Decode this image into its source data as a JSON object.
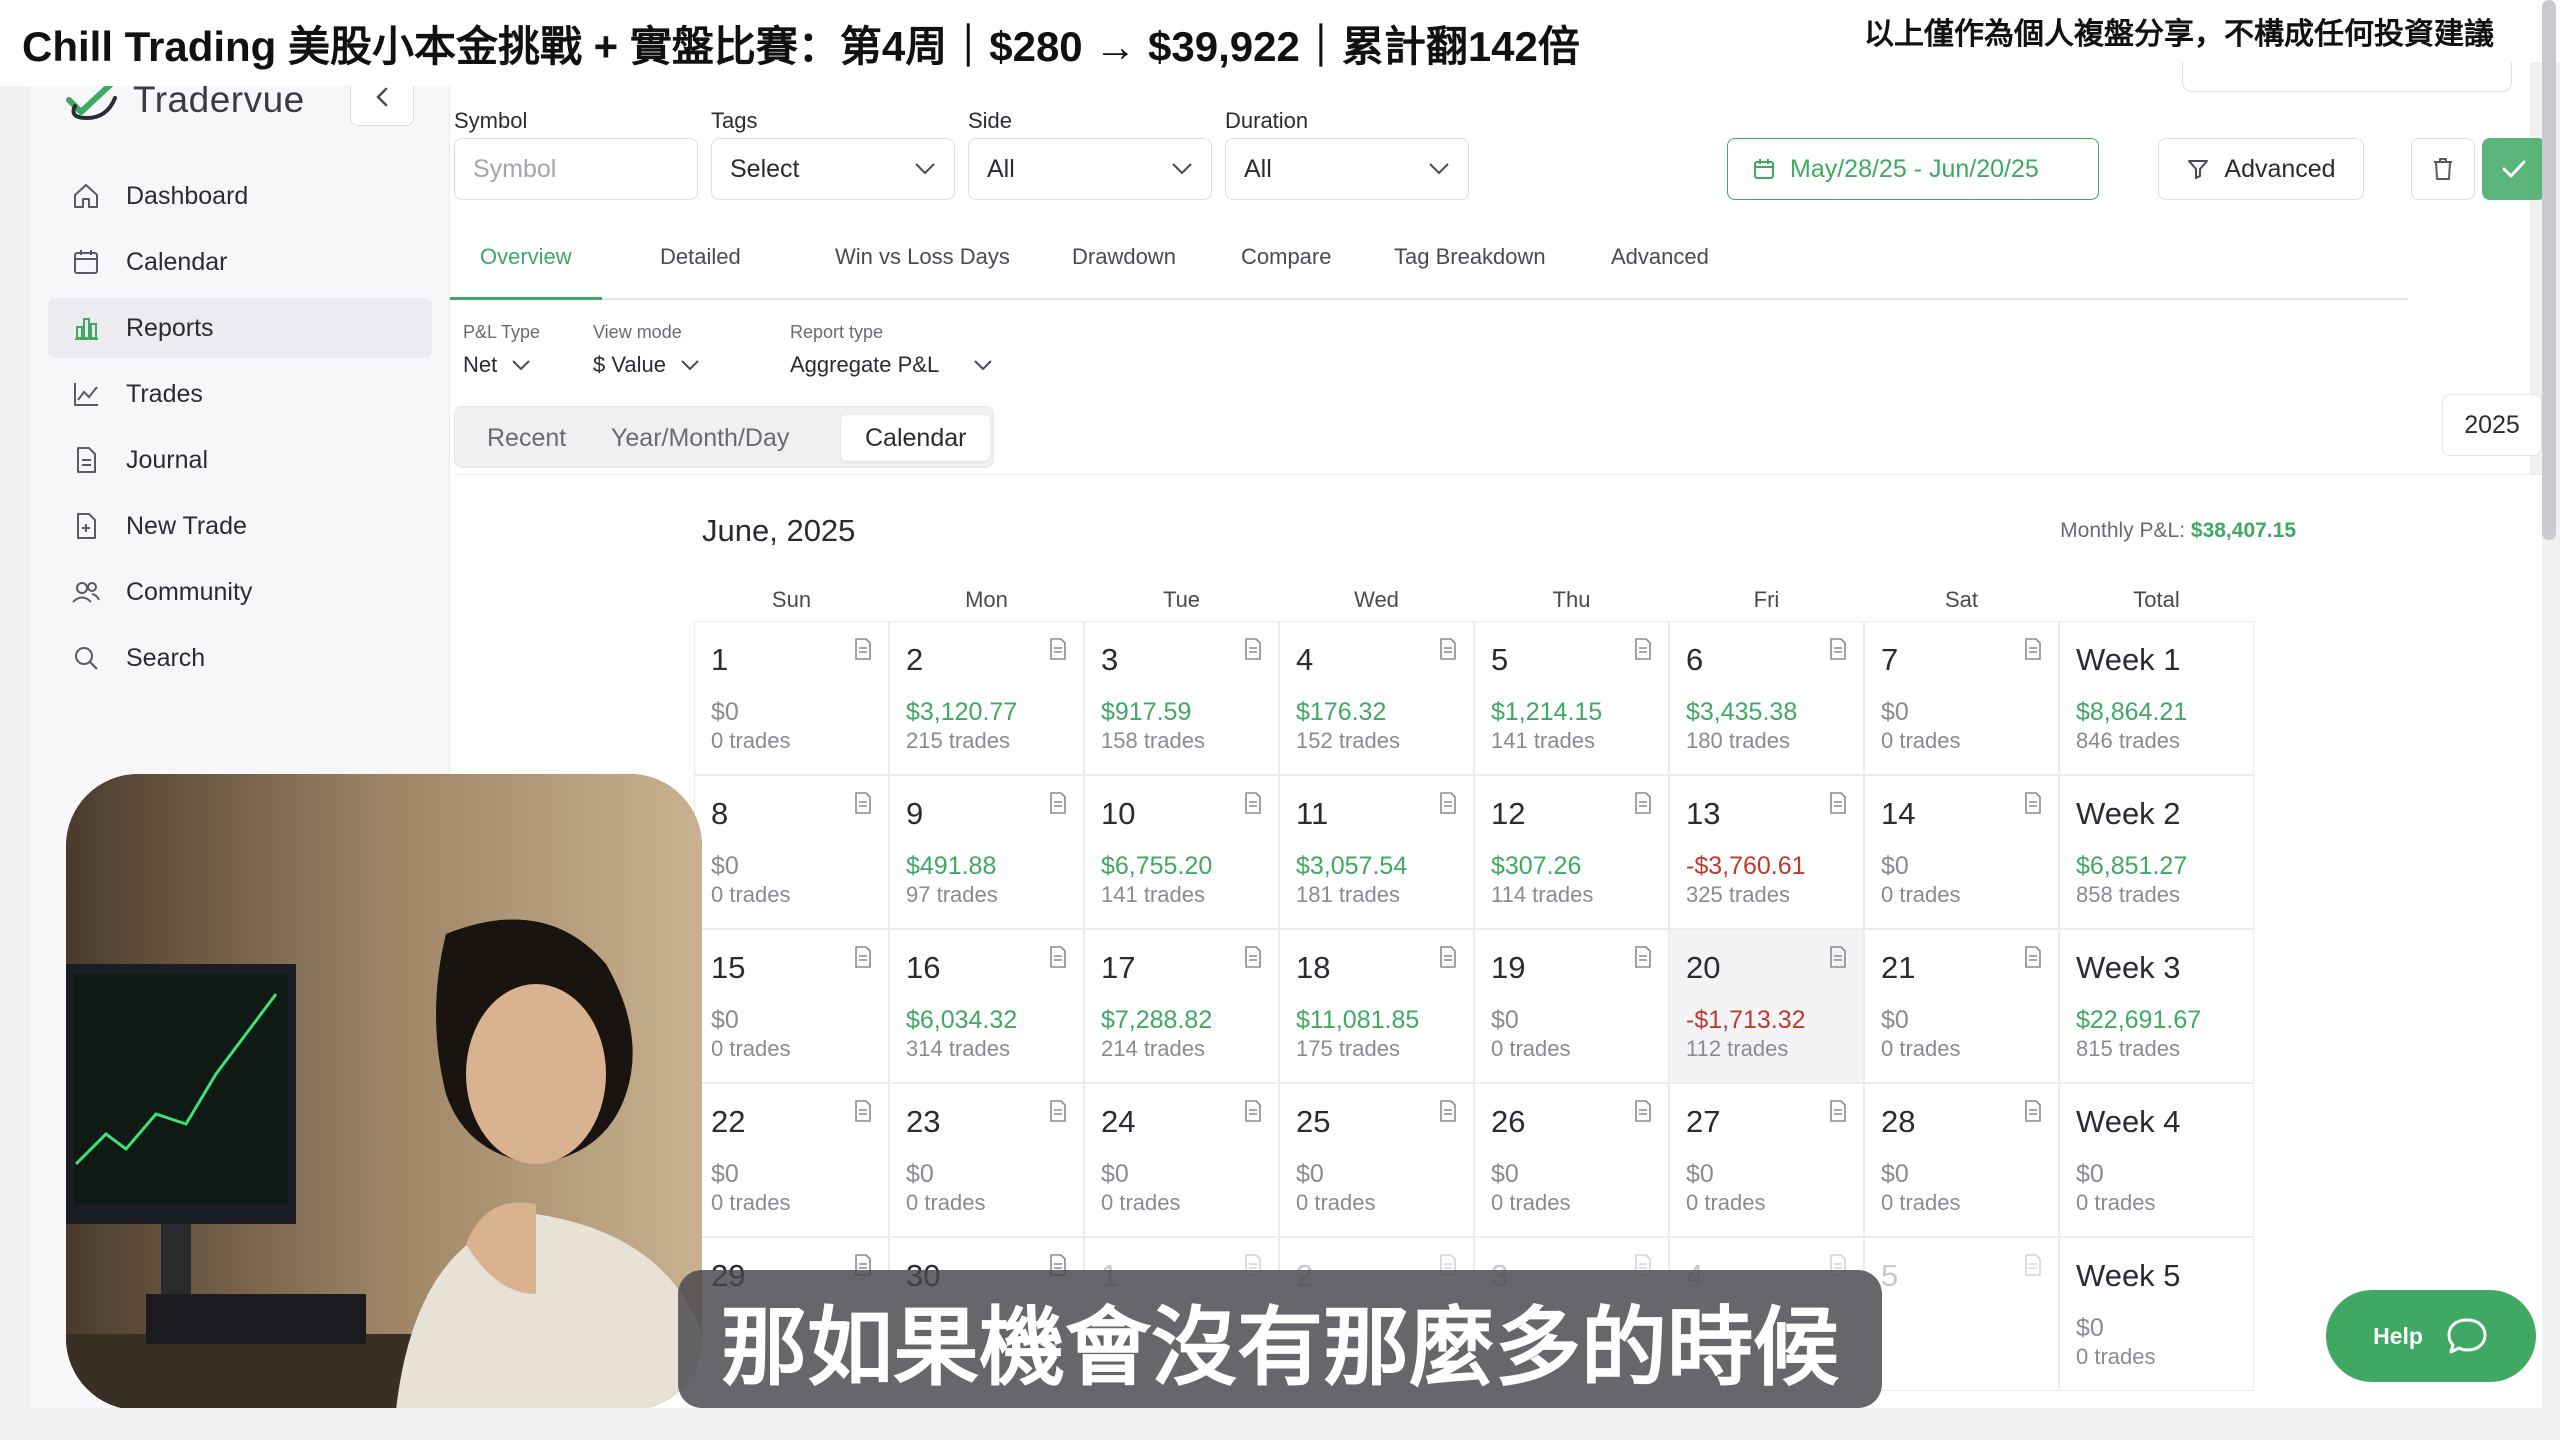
{
  "overlay": {
    "title": "Chill Trading 美股小本金挑戰 + 實盤比賽：第4周｜$280 → $39,922｜累計翻142倍",
    "disclaimer": "以上僅作為個人複盤分享，不構成任何投資建議",
    "subtitle": "那如果機會沒有那麼多的時候"
  },
  "app": {
    "name": "Tradervue"
  },
  "sidebar": {
    "items": [
      {
        "label": "Dashboard",
        "icon": "home-icon"
      },
      {
        "label": "Calendar",
        "icon": "calendar-icon"
      },
      {
        "label": "Reports",
        "icon": "bar-chart-icon",
        "active": true
      },
      {
        "label": "Trades",
        "icon": "line-chart-icon"
      },
      {
        "label": "Journal",
        "icon": "document-icon"
      },
      {
        "label": "New Trade",
        "icon": "new-document-icon"
      },
      {
        "label": "Community",
        "icon": "users-icon"
      },
      {
        "label": "Search",
        "icon": "search-icon"
      }
    ]
  },
  "filters": {
    "symbol": {
      "label": "Symbol",
      "placeholder": "Symbol"
    },
    "tags": {
      "label": "Tags",
      "value": "Select"
    },
    "side": {
      "label": "Side",
      "value": "All"
    },
    "duration": {
      "label": "Duration",
      "value": "All"
    },
    "date_range": "May/28/25 - Jun/20/25",
    "advanced": "Advanced"
  },
  "tabs": [
    "Overview",
    "Detailed",
    "Win vs Loss Days",
    "Drawdown",
    "Compare",
    "Tag Breakdown",
    "Advanced"
  ],
  "options": {
    "pl_type": {
      "label": "P&L Type",
      "value": "Net"
    },
    "view_mode": {
      "label": "View mode",
      "value": "$ Value"
    },
    "report_type": {
      "label": "Report type",
      "value": "Aggregate P&L"
    }
  },
  "view_tabs": [
    "Recent",
    "Year/Month/Day",
    "Calendar"
  ],
  "year": "2025",
  "calendar": {
    "month": "June, 2025",
    "monthly_pnl_label": "Monthly P&L:",
    "monthly_pnl_value": "$38,407.15",
    "headers": [
      "Sun",
      "Mon",
      "Tue",
      "Wed",
      "Thu",
      "Fri",
      "Sat",
      "Total"
    ],
    "weeks": [
      [
        {
          "day": "1",
          "pnl": "$0",
          "trades": "0 trades",
          "tone": "zero"
        },
        {
          "day": "2",
          "pnl": "$3,120.77",
          "trades": "215 trades",
          "tone": "pos"
        },
        {
          "day": "3",
          "pnl": "$917.59",
          "trades": "158 trades",
          "tone": "pos"
        },
        {
          "day": "4",
          "pnl": "$176.32",
          "trades": "152 trades",
          "tone": "pos"
        },
        {
          "day": "5",
          "pnl": "$1,214.15",
          "trades": "141 trades",
          "tone": "pos"
        },
        {
          "day": "6",
          "pnl": "$3,435.38",
          "trades": "180 trades",
          "tone": "pos"
        },
        {
          "day": "7",
          "pnl": "$0",
          "trades": "0 trades",
          "tone": "zero"
        },
        {
          "day": "Week 1",
          "pnl": "$8,864.21",
          "trades": "846 trades",
          "tone": "pos"
        }
      ],
      [
        {
          "day": "8",
          "pnl": "$0",
          "trades": "0 trades",
          "tone": "zero"
        },
        {
          "day": "9",
          "pnl": "$491.88",
          "trades": "97 trades",
          "tone": "pos"
        },
        {
          "day": "10",
          "pnl": "$6,755.20",
          "trades": "141 trades",
          "tone": "pos"
        },
        {
          "day": "11",
          "pnl": "$3,057.54",
          "trades": "181 trades",
          "tone": "pos"
        },
        {
          "day": "12",
          "pnl": "$307.26",
          "trades": "114 trades",
          "tone": "pos"
        },
        {
          "day": "13",
          "pnl": "-$3,760.61",
          "trades": "325 trades",
          "tone": "neg"
        },
        {
          "day": "14",
          "pnl": "$0",
          "trades": "0 trades",
          "tone": "zero"
        },
        {
          "day": "Week 2",
          "pnl": "$6,851.27",
          "trades": "858 trades",
          "tone": "pos"
        }
      ],
      [
        {
          "day": "15",
          "pnl": "$0",
          "trades": "0 trades",
          "tone": "zero"
        },
        {
          "day": "16",
          "pnl": "$6,034.32",
          "trades": "314 trades",
          "tone": "pos"
        },
        {
          "day": "17",
          "pnl": "$7,288.82",
          "trades": "214 trades",
          "tone": "pos"
        },
        {
          "day": "18",
          "pnl": "$11,081.85",
          "trades": "175 trades",
          "tone": "pos"
        },
        {
          "day": "19",
          "pnl": "$0",
          "trades": "0 trades",
          "tone": "zero"
        },
        {
          "day": "20",
          "pnl": "-$1,713.32",
          "trades": "112 trades",
          "tone": "neg",
          "highlight": true
        },
        {
          "day": "21",
          "pnl": "$0",
          "trades": "0 trades",
          "tone": "zero"
        },
        {
          "day": "Week 3",
          "pnl": "$22,691.67",
          "trades": "815 trades",
          "tone": "pos"
        }
      ],
      [
        {
          "day": "22",
          "pnl": "$0",
          "trades": "0 trades",
          "tone": "zero"
        },
        {
          "day": "23",
          "pnl": "$0",
          "trades": "0 trades",
          "tone": "zero"
        },
        {
          "day": "24",
          "pnl": "$0",
          "trades": "0 trades",
          "tone": "zero"
        },
        {
          "day": "25",
          "pnl": "$0",
          "trades": "0 trades",
          "tone": "zero"
        },
        {
          "day": "26",
          "pnl": "$0",
          "trades": "0 trades",
          "tone": "zero"
        },
        {
          "day": "27",
          "pnl": "$0",
          "trades": "0 trades",
          "tone": "zero"
        },
        {
          "day": "28",
          "pnl": "$0",
          "trades": "0 trades",
          "tone": "zero"
        },
        {
          "day": "Week 4",
          "pnl": "$0",
          "trades": "0 trades",
          "tone": "zero"
        }
      ],
      [
        {
          "day": "29",
          "pnl": "",
          "trades": "",
          "tone": "zero"
        },
        {
          "day": "30",
          "pnl": "",
          "trades": "",
          "tone": "zero"
        },
        {
          "day": "1",
          "pnl": "",
          "trades": "",
          "tone": "zero",
          "faded": true
        },
        {
          "day": "2",
          "pnl": "",
          "trades": "",
          "tone": "zero",
          "faded": true
        },
        {
          "day": "3",
          "pnl": "",
          "trades": "",
          "tone": "zero",
          "faded": true
        },
        {
          "day": "4",
          "pnl": "",
          "trades": "",
          "tone": "zero",
          "faded": true
        },
        {
          "day": "5",
          "pnl": "",
          "trades": "",
          "tone": "zero",
          "faded": true
        },
        {
          "day": "Week 5",
          "pnl": "$0",
          "trades": "0 trades",
          "tone": "zero"
        }
      ]
    ]
  },
  "help": {
    "label": "Help",
    "icon": "chat-bubble-icon"
  },
  "colors": {
    "accent": "#3fa963",
    "negative": "#c0392b"
  }
}
